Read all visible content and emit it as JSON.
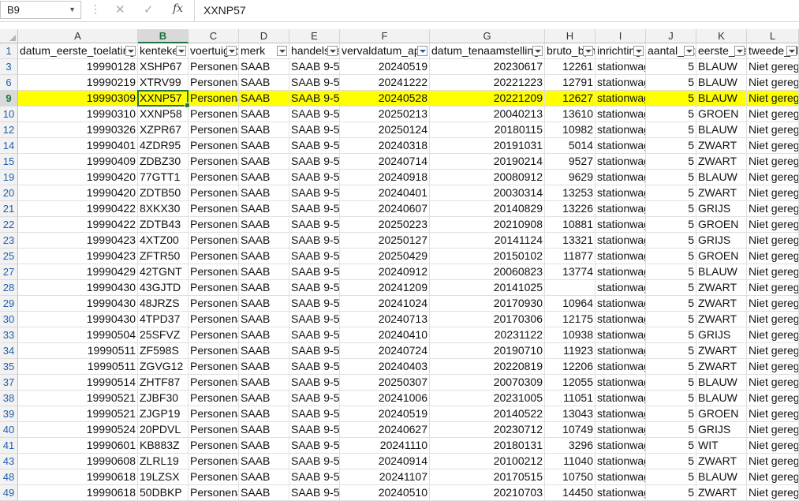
{
  "formula_bar": {
    "name_box": "B9",
    "cancel_icon": "✕",
    "enter_icon": "✓",
    "function_label": "fx",
    "value": "XXNP57"
  },
  "columns": [
    "A",
    "B",
    "C",
    "D",
    "E",
    "F",
    "G",
    "H",
    "I",
    "J",
    "K",
    "L"
  ],
  "selected_column": "B",
  "headers": [
    "datum_eerste_toelating",
    "kenteken",
    "voertuigsoort",
    "merk",
    "handelsbenaming",
    "vervaldatum_apk",
    "datum_tenaamstelling",
    "bruto_bpm",
    "inrichting",
    "aantal_zitplaatsen",
    "eerste_kleur",
    "tweede_kleur"
  ],
  "filtered_column": "F",
  "selected_row": "9",
  "rows": [
    {
      "n": "3",
      "v": [
        "19990128",
        "XSHP67",
        "Personenauto",
        "SAAB",
        "SAAB 9-5",
        "20240519",
        "20230617",
        "12261",
        "stationwagen",
        "5",
        "BLAUW",
        "Niet geregistreerd"
      ]
    },
    {
      "n": "6",
      "v": [
        "19990219",
        "XTRV99",
        "Personenauto",
        "SAAB",
        "SAAB 9-5",
        "20241222",
        "20221223",
        "12791",
        "stationwagen",
        "5",
        "BLAUW",
        "Niet geregistreerd"
      ]
    },
    {
      "n": "9",
      "v": [
        "19990309",
        "XXNP57",
        "Personenauto",
        "SAAB",
        "SAAB 9-5",
        "20240528",
        "20221209",
        "12627",
        "stationwagen",
        "5",
        "BLAUW",
        "Niet geregistreerd"
      ]
    },
    {
      "n": "10",
      "v": [
        "19990310",
        "XXNP58",
        "Personenauto",
        "SAAB",
        "SAAB 9-5",
        "20250213",
        "20040213",
        "13610",
        "stationwagen",
        "5",
        "GROEN",
        "Niet geregistreerd"
      ]
    },
    {
      "n": "12",
      "v": [
        "19990326",
        "XZPR67",
        "Personenauto",
        "SAAB",
        "SAAB 9-5",
        "20250124",
        "20180115",
        "10982",
        "stationwagen",
        "5",
        "BLAUW",
        "Niet geregistreerd"
      ]
    },
    {
      "n": "14",
      "v": [
        "19990401",
        "4ZDR95",
        "Personenauto",
        "SAAB",
        "SAAB 9-5",
        "20240318",
        "20191031",
        "5014",
        "stationwagen",
        "5",
        "ZWART",
        "Niet geregistreerd"
      ]
    },
    {
      "n": "15",
      "v": [
        "19990409",
        "ZDBZ30",
        "Personenauto",
        "SAAB",
        "SAAB 9-5",
        "20240714",
        "20190214",
        "9527",
        "stationwagen",
        "5",
        "ZWART",
        "Niet geregistreerd"
      ]
    },
    {
      "n": "19",
      "v": [
        "19990420",
        "77GTT1",
        "Personenauto",
        "SAAB",
        "SAAB 9-5",
        "20240918",
        "20080912",
        "9629",
        "stationwagen",
        "5",
        "BLAUW",
        "Niet geregistreerd"
      ]
    },
    {
      "n": "20",
      "v": [
        "19990420",
        "ZDTB50",
        "Personenauto",
        "SAAB",
        "SAAB 9-5",
        "20240401",
        "20030314",
        "13253",
        "stationwagen",
        "5",
        "ZWART",
        "Niet geregistreerd"
      ]
    },
    {
      "n": "21",
      "v": [
        "19990422",
        "8XKX30",
        "Personenauto",
        "SAAB",
        "SAAB 9-5",
        "20240607",
        "20140829",
        "13226",
        "stationwagen",
        "5",
        "GRIJS",
        "Niet geregistreerd"
      ]
    },
    {
      "n": "22",
      "v": [
        "19990422",
        "ZDTB43",
        "Personenauto",
        "SAAB",
        "SAAB 9-5",
        "20250223",
        "20210908",
        "10881",
        "stationwagen",
        "5",
        "GROEN",
        "Niet geregistreerd"
      ]
    },
    {
      "n": "23",
      "v": [
        "19990423",
        "4XTZ00",
        "Personenauto",
        "SAAB",
        "SAAB 9-5",
        "20250127",
        "20141124",
        "13321",
        "stationwagen",
        "5",
        "GRIJS",
        "Niet geregistreerd"
      ]
    },
    {
      "n": "25",
      "v": [
        "19990423",
        "ZFTR50",
        "Personenauto",
        "SAAB",
        "SAAB 9-5",
        "20250429",
        "20150102",
        "11877",
        "stationwagen",
        "5",
        "GROEN",
        "Niet geregistreerd"
      ]
    },
    {
      "n": "27",
      "v": [
        "19990429",
        "42TGNT",
        "Personenauto",
        "SAAB",
        "SAAB 9-5",
        "20240912",
        "20060823",
        "13774",
        "stationwagen",
        "5",
        "BLAUW",
        "Niet geregistreerd"
      ]
    },
    {
      "n": "28",
      "v": [
        "19990430",
        "43GJTD",
        "Personenauto",
        "SAAB",
        "SAAB 9-5",
        "20241209",
        "20141025",
        "",
        "stationwagen",
        "5",
        "ZWART",
        "Niet geregistreerd"
      ]
    },
    {
      "n": "29",
      "v": [
        "19990430",
        "48JRZS",
        "Personenauto",
        "SAAB",
        "SAAB 9-5",
        "20241024",
        "20170930",
        "10964",
        "stationwagen",
        "5",
        "ZWART",
        "Niet geregistreerd"
      ]
    },
    {
      "n": "30",
      "v": [
        "19990430",
        "4TPD37",
        "Personenauto",
        "SAAB",
        "SAAB 9-5",
        "20240713",
        "20170306",
        "12175",
        "stationwagen",
        "5",
        "ZWART",
        "Niet geregistreerd"
      ]
    },
    {
      "n": "33",
      "v": [
        "19990504",
        "25SFVZ",
        "Personenauto",
        "SAAB",
        "SAAB 9-5",
        "20240410",
        "20231122",
        "10938",
        "stationwagen",
        "5",
        "GRIJS",
        "Niet geregistreerd"
      ]
    },
    {
      "n": "34",
      "v": [
        "19990511",
        "ZF598S",
        "Personenauto",
        "SAAB",
        "SAAB 9-5",
        "20240724",
        "20190710",
        "11923",
        "stationwagen",
        "5",
        "ZWART",
        "Niet geregistreerd"
      ]
    },
    {
      "n": "35",
      "v": [
        "19990511",
        "ZGVG12",
        "Personenauto",
        "SAAB",
        "SAAB 9-5",
        "20240403",
        "20220819",
        "12206",
        "stationwagen",
        "5",
        "ZWART",
        "Niet geregistreerd"
      ]
    },
    {
      "n": "37",
      "v": [
        "19990514",
        "ZHTF87",
        "Personenauto",
        "SAAB",
        "SAAB 9-5",
        "20250307",
        "20070309",
        "12055",
        "stationwagen",
        "5",
        "BLAUW",
        "Niet geregistreerd"
      ]
    },
    {
      "n": "38",
      "v": [
        "19990521",
        "ZJBF30",
        "Personenauto",
        "SAAB",
        "SAAB 9-5",
        "20241006",
        "20231005",
        "11051",
        "stationwagen",
        "5",
        "BLAUW",
        "Niet geregistreerd"
      ]
    },
    {
      "n": "39",
      "v": [
        "19990521",
        "ZJGP19",
        "Personenauto",
        "SAAB",
        "SAAB 9-5",
        "20240519",
        "20140522",
        "13043",
        "stationwagen",
        "5",
        "GROEN",
        "Niet geregistreerd"
      ]
    },
    {
      "n": "40",
      "v": [
        "19990524",
        "20PDVL",
        "Personenauto",
        "SAAB",
        "SAAB 9-5",
        "20240627",
        "20230712",
        "10749",
        "stationwagen",
        "5",
        "GRIJS",
        "Niet geregistreerd"
      ]
    },
    {
      "n": "41",
      "v": [
        "19990601",
        "KB883Z",
        "Personenauto",
        "SAAB",
        "SAAB 9-5",
        "20241110",
        "20180131",
        "3296",
        "stationwagen",
        "5",
        "WIT",
        "Niet geregistreerd"
      ]
    },
    {
      "n": "43",
      "v": [
        "19990608",
        "ZLRL19",
        "Personenauto",
        "SAAB",
        "SAAB 9-5",
        "20240914",
        "20100212",
        "11040",
        "stationwagen",
        "5",
        "ZWART",
        "Niet geregistreerd"
      ]
    },
    {
      "n": "48",
      "v": [
        "19990618",
        "19LZSX",
        "Personenauto",
        "SAAB",
        "SAAB 9-5",
        "20241107",
        "20170515",
        "10750",
        "stationwagen",
        "5",
        "BLAUW",
        "Niet geregistreerd"
      ]
    },
    {
      "n": "49",
      "v": [
        "19990618",
        "50DBKP",
        "Personenauto",
        "SAAB",
        "SAAB 9-5",
        "20240510",
        "20210703",
        "14450",
        "stationwagen",
        "5",
        "ZWART",
        "Niet geregistreerd"
      ]
    }
  ],
  "colors": {
    "highlight": "#ffff00",
    "selection": "#217346"
  }
}
